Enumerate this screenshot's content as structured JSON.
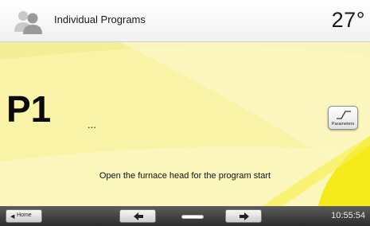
{
  "header": {
    "title": "Individual Programs",
    "temperature": "27°",
    "user_icon": "user-icon"
  },
  "main": {
    "program_number": "P1",
    "program_name": "...",
    "parameters_label": "Parameters",
    "parameters_icon": "temperature-curve-icon",
    "status_message": "Open the furnace head for the program start",
    "background_color": "#f8f3a6",
    "accent_color": "#f5ea1a"
  },
  "bottom_bar": {
    "home_label": "Home",
    "prev_icon": "arrow-left-icon",
    "next_icon": "arrow-right-icon",
    "page_indicator_icon": "page-indicator-icon",
    "time": "10:55:54"
  }
}
